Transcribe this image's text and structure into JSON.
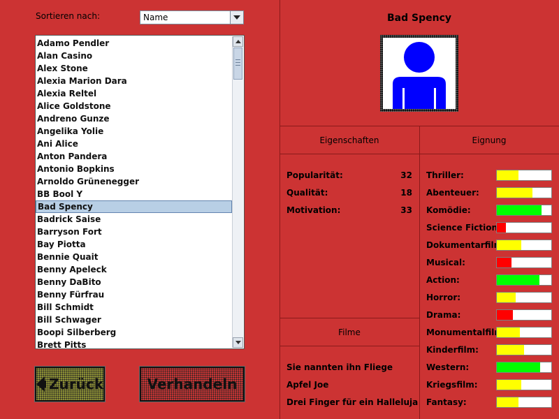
{
  "sort": {
    "label": "Sortieren nach:",
    "selected": "Name"
  },
  "actors": [
    "Adamo Pendler",
    "Alan Casino",
    "Alex Stone",
    "Alexia Marion Dara",
    "Alexia Reltel",
    "Alice Goldstone",
    "Andreno Gunze",
    "Angelika Yolie",
    "Ani Alice",
    "Anton Pandera",
    "Antonio Bopkins",
    "Arnoldo Grünenegger",
    "BB Bool Y",
    "Bad Spency",
    "Badrick Saise",
    "Barryson Fort",
    "Bay Piotta",
    "Bennie Quait",
    "Benny Apeleck",
    "Benny DaBito",
    "Benny Fürfrau",
    "Bill Schmidt",
    "Bill Schwager",
    "Boopi Silberberg",
    "Brett Pitts"
  ],
  "selected_actor_index": 13,
  "buttons": {
    "back": "Zurück",
    "negotiate": "Verhandeln"
  },
  "detail": {
    "name": "Bad Spency",
    "properties_heading": "Eigenschaften",
    "suitability_heading": "Eignung",
    "films_heading": "Filme",
    "properties": [
      {
        "label": "Popularität:",
        "value": "32"
      },
      {
        "label": "Qualität:",
        "value": "18"
      },
      {
        "label": "Motivation:",
        "value": "33"
      }
    ],
    "films": [
      "Sie nannten ihn Fliege",
      "Apfel Joe",
      "Drei Finger für ein Halleluja"
    ],
    "genres": [
      {
        "label": "Thriller:",
        "level": 0.4,
        "color": "#ffff00"
      },
      {
        "label": "Abenteuer:",
        "level": 0.65,
        "color": "#ffff00"
      },
      {
        "label": "Komödie:",
        "level": 0.82,
        "color": "#00ff00"
      },
      {
        "label": "Science Fiction:",
        "level": 0.17,
        "color": "#ff0000"
      },
      {
        "label": "Dokumentarfilm:",
        "level": 0.45,
        "color": "#ffff00"
      },
      {
        "label": "Musical:",
        "level": 0.27,
        "color": "#ff0000"
      },
      {
        "label": "Action:",
        "level": 0.78,
        "color": "#00ff00"
      },
      {
        "label": "Horror:",
        "level": 0.35,
        "color": "#ffff00"
      },
      {
        "label": "Drama:",
        "level": 0.3,
        "color": "#ff0000"
      },
      {
        "label": "Monumentalfilm:",
        "level": 0.42,
        "color": "#ffff00"
      },
      {
        "label": "Kinderfilm:",
        "level": 0.5,
        "color": "#ffff00"
      },
      {
        "label": "Western:",
        "level": 0.8,
        "color": "#00ff00"
      },
      {
        "label": "Kriegsfilm:",
        "level": 0.45,
        "color": "#ffff00"
      },
      {
        "label": "Fantasy:",
        "level": 0.4,
        "color": "#ffff00"
      }
    ]
  },
  "icons": {
    "portrait": "person-silhouette-icon",
    "back": "left-arrow-icon"
  },
  "colors": {
    "background": "#cc3333",
    "selection": "#b8cfe5",
    "portrait_figure": "#0000ff"
  }
}
